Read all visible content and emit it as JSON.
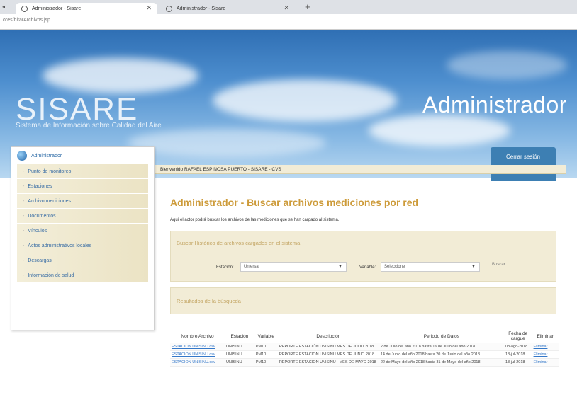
{
  "browser": {
    "tabs": [
      {
        "title": "Administrador - Sisare",
        "active": true
      },
      {
        "title": "Administrador - Sisare",
        "active": false
      }
    ],
    "new_tab": "+",
    "url": "ores/bitarArchivos.jsp"
  },
  "banner": {
    "logo": "SISARE",
    "logo_subtitle": "Sistema de Información sobre Calidad del Aire",
    "role_title": "Administrador",
    "logout_label": "Cerrar sesión"
  },
  "welcome": "Bienvenido RAFAEL ESPINOSA PUERTO - SISARE - CVS",
  "sidebar": {
    "header": "Administrador",
    "items": [
      {
        "label": "Punto de monitoreo"
      },
      {
        "label": "Estaciones"
      },
      {
        "label": "Archivo mediciones"
      },
      {
        "label": "Documentos"
      },
      {
        "label": "Vínculos"
      },
      {
        "label": "Actos administrativos locales"
      },
      {
        "label": "Descargas"
      },
      {
        "label": "Información de salud"
      }
    ]
  },
  "main": {
    "title": "Administrador - Buscar archivos mediciones por red",
    "description": "Aquí el actor podrá buscar los archivos de las mediciones que se han cargado al sistema.",
    "search": {
      "title": "Buscar Histórico de archivos cargados en el sistema",
      "station_label": "Estación:",
      "station_value": "Uniersa",
      "variable_label": "Variable:",
      "variable_value": "Seleccione",
      "search_button": "Buscar"
    },
    "results_title": "Resultados de la búsqueda",
    "table": {
      "headers": [
        "Nombre Archivo",
        "Estación",
        "Variable",
        "Descripción",
        "Periodo de Datos",
        "Fecha de cargue",
        "Eliminar"
      ],
      "rows": [
        {
          "file": "ESTACION UNISINU.csv",
          "station": "UNISINU",
          "variable": "PM10",
          "description": "REPORTE ESTACIÓN UNISINU MES DE JULIO 2018",
          "period": "2 de Julio del año 2018 hasta 16 de Julio del año 2018",
          "date": "08-ago-2018",
          "delete": "Eliminar"
        },
        {
          "file": "ESTACION UNISINU.csv",
          "station": "UNISINU",
          "variable": "PM10",
          "description": "REPORTE ESTACIÓN UNISINU MES DE JUNIO 2018",
          "period": "14 de Junio del año 2018 hasta 20 de Junio del año 2018",
          "date": "18-jul-2018",
          "delete": "Eliminar"
        },
        {
          "file": "ESTACION UNISINU.csv",
          "station": "UNISINU",
          "variable": "PM10",
          "description": "REPORTE ESTACIÓN UNISINU - MES DE MAYO 2018",
          "period": "22 de Mayo del año 2018 hasta 31 de Mayo del año 2018",
          "date": "18-jul-2018",
          "delete": "Eliminar"
        }
      ]
    }
  }
}
